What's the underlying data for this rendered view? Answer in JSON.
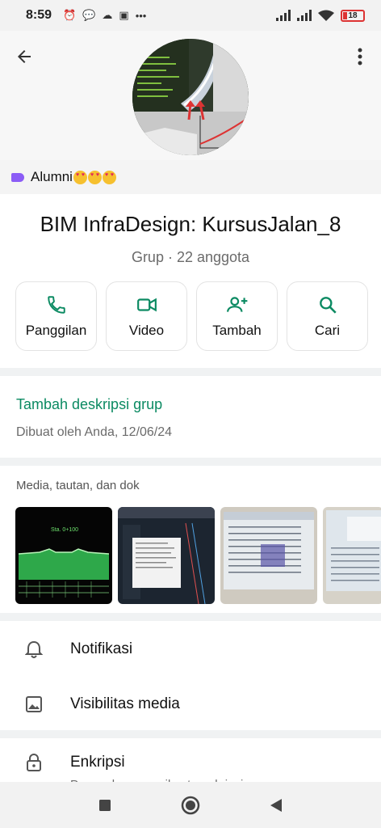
{
  "status_bar": {
    "time": "8:59",
    "more": "•••",
    "battery": "18"
  },
  "group": {
    "community_name": "Alumni",
    "title": "BIM InfraDesign: KursusJalan_8",
    "subtitle": "Grup · 22 anggota"
  },
  "actions": [
    {
      "label": "Panggilan",
      "icon": "phone-icon"
    },
    {
      "label": "Video",
      "icon": "video-icon"
    },
    {
      "label": "Tambah",
      "icon": "add-person-icon"
    },
    {
      "label": "Cari",
      "icon": "search-icon"
    }
  ],
  "description": {
    "add_label": "Tambah deskripsi grup",
    "created_by": "Dibuat oleh Anda, 12/06/24"
  },
  "media": {
    "heading": "Media, tautan, dan dok",
    "thumb_1_label": "Sta. 0+100"
  },
  "settings": [
    {
      "label": "Notifikasi",
      "icon": "bell-icon"
    },
    {
      "label": "Visibilitas media",
      "icon": "image-icon"
    },
    {
      "label": "Enkripsi",
      "icon": "lock-icon",
      "sublabel": "Pesan dan panggilan terenkripsi secara"
    }
  ],
  "colors": {
    "accent": "#0b8a62",
    "community_tag": "#8b5cf6"
  }
}
